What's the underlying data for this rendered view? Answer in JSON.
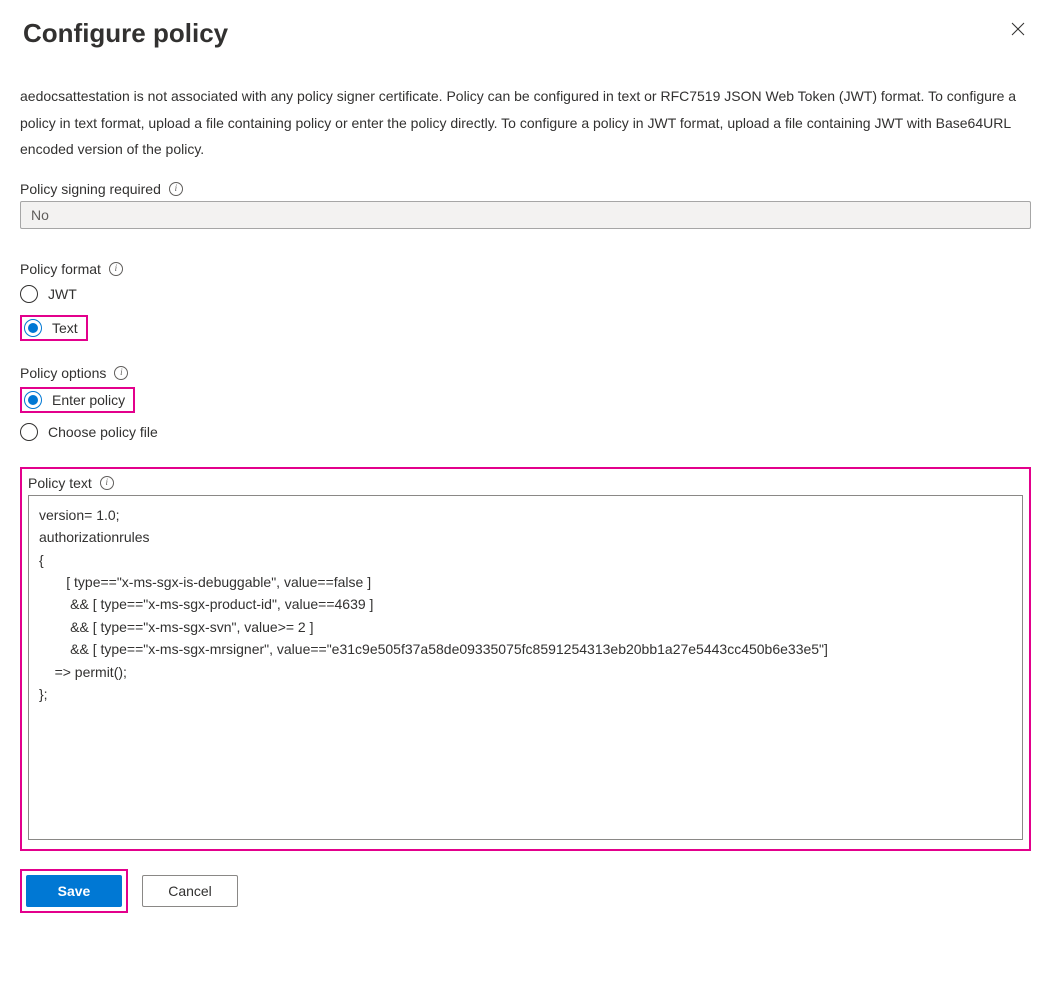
{
  "header": {
    "title": "Configure policy",
    "close_icon_name": "close-icon"
  },
  "description": "aedocsattestation is not associated with any policy signer certificate. Policy can be configured in text or RFC7519 JSON Web Token (JWT) format. To configure a policy in text format, upload a file containing policy or enter the policy directly. To configure a policy in JWT format, upload a file containing JWT with Base64URL encoded version of the policy.",
  "signing": {
    "label": "Policy signing required",
    "value": "No"
  },
  "format": {
    "label": "Policy format",
    "options": {
      "jwt": "JWT",
      "text": "Text"
    },
    "selected": "text"
  },
  "options": {
    "label": "Policy options",
    "items": {
      "enter": "Enter policy",
      "choose": "Choose policy file"
    },
    "selected": "enter"
  },
  "policy_text": {
    "label": "Policy text",
    "value": "version= 1.0;\nauthorizationrules\n{\n       [ type==\"x-ms-sgx-is-debuggable\", value==false ]\n        && [ type==\"x-ms-sgx-product-id\", value==4639 ]\n        && [ type==\"x-ms-sgx-svn\", value>= 2 ]\n        && [ type==\"x-ms-sgx-mrsigner\", value==\"e31c9e505f37a58de09335075fc8591254313eb20bb1a27e5443cc450b6e33e5\"]\n    => permit();\n};"
  },
  "buttons": {
    "save": "Save",
    "cancel": "Cancel"
  },
  "colors": {
    "primary": "#0078d4",
    "highlight": "#e3008c"
  }
}
